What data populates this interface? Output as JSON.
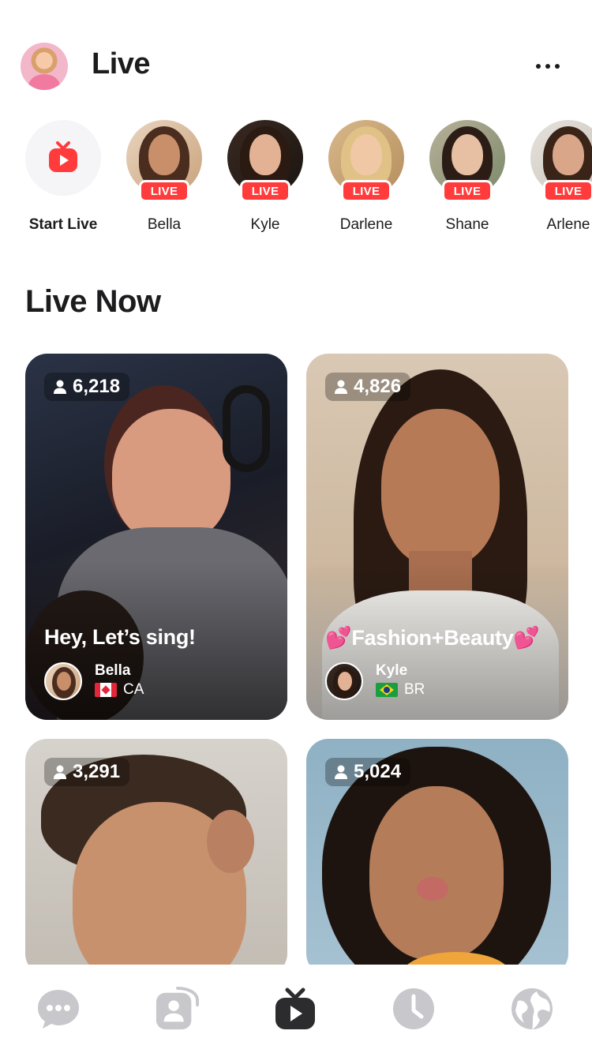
{
  "header": {
    "title": "Live"
  },
  "stories": {
    "badge": "LIVE",
    "start_label": "Start Live",
    "items": [
      {
        "name": "Bella"
      },
      {
        "name": "Kyle"
      },
      {
        "name": "Darlene"
      },
      {
        "name": "Shane"
      },
      {
        "name": "Arlene"
      }
    ]
  },
  "section": {
    "title": "Live Now"
  },
  "cards": [
    {
      "viewers": "6,218",
      "caption": "Hey, Let’s sing!",
      "host": "Bella",
      "country": "CA",
      "flag": "ca-flag-icon"
    },
    {
      "viewers": "4,826",
      "caption": "💕Fashion+Beauty💕",
      "host": "Kyle",
      "country": "BR",
      "flag": "br-flag-icon"
    },
    {
      "viewers": "3,291"
    },
    {
      "viewers": "5,024"
    }
  ],
  "tabbar": {
    "items": [
      {
        "icon": "chat-icon"
      },
      {
        "icon": "contacts-icon"
      },
      {
        "icon": "live-tv-icon",
        "active": true
      },
      {
        "icon": "clock-icon"
      },
      {
        "icon": "globe-icon"
      }
    ]
  },
  "colors": {
    "accent": "#ff3b3b",
    "text": "#1c1c1e",
    "tab_inactive": "#c7c7cc",
    "tab_active": "#2c2c2e"
  }
}
